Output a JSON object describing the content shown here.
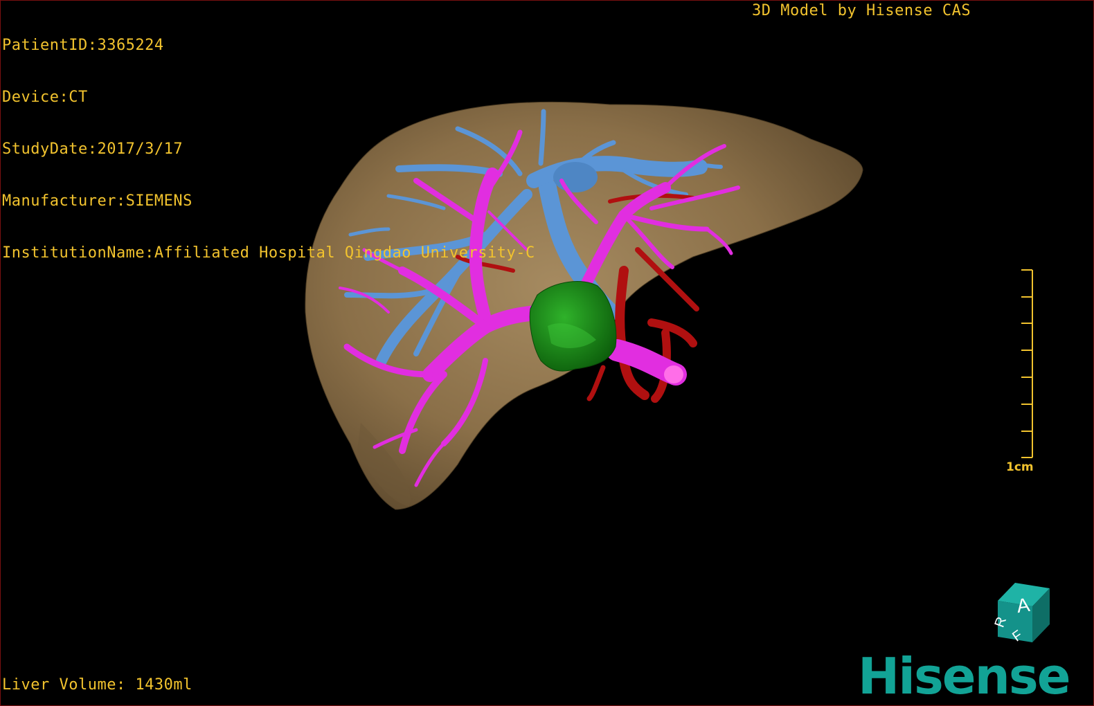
{
  "patient_info": [
    "PatientID:3365224",
    "Device:CT",
    "StudyDate:2017/3/17",
    "Manufacturer:SIEMENS",
    "InstitutionName:Affiliated Hospital Qingdao University-C"
  ],
  "header_right": "3D Model by Hisense CAS",
  "liver_volume": "Liver Volume: 1430ml",
  "scale_bar": {
    "label": "1cm"
  },
  "orientation_cube": {
    "labels": [
      "A",
      "R",
      "F"
    ]
  },
  "brand": "Hisense",
  "colors": {
    "background": "#000000",
    "overlay_text": "#f2c32e",
    "liver": "#8a6f48",
    "hepatic_vein": "#5b95d6",
    "portal_vein": "#e12ee0",
    "hepatic_artery": "#b01010",
    "tumor": "#1a8a18",
    "brand": "#12a396"
  },
  "structures": [
    "liver",
    "hepatic-vein",
    "portal-vein",
    "hepatic-artery",
    "tumor"
  ]
}
